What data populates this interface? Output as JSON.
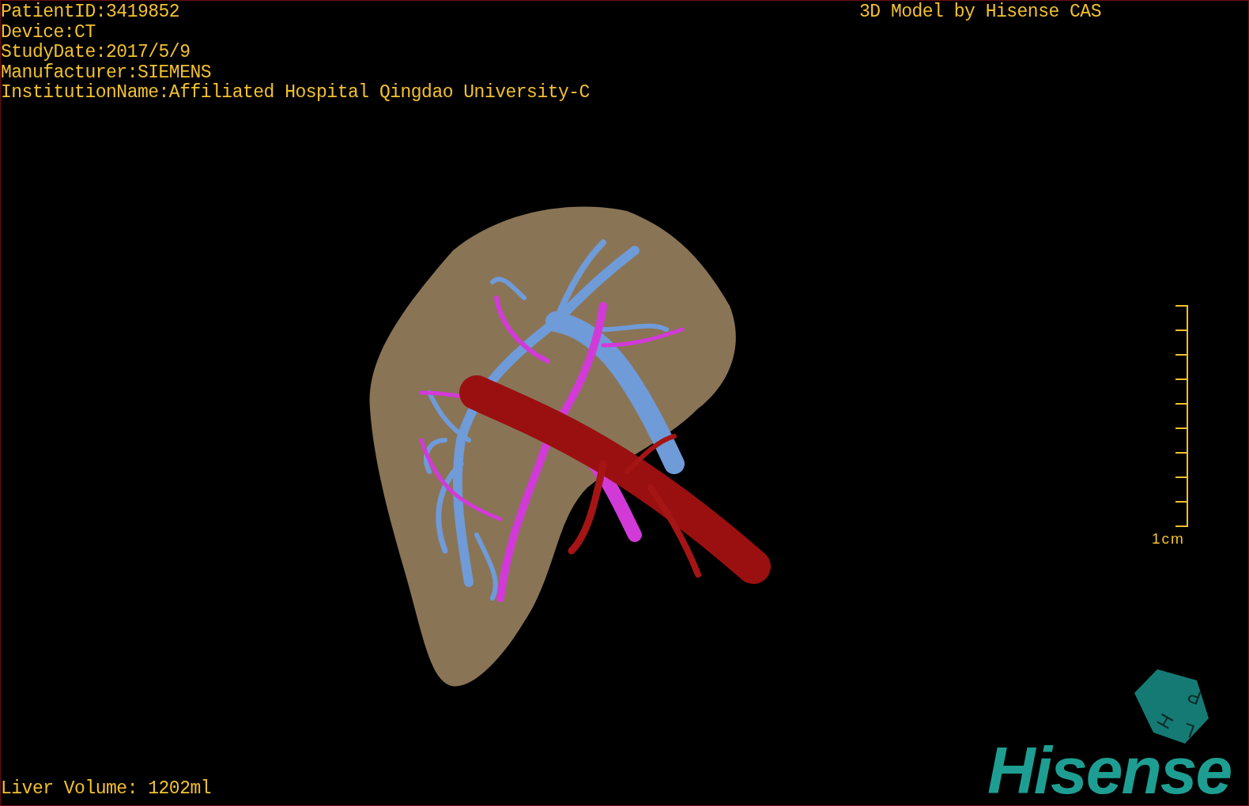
{
  "patient_info": [
    "PatientID:3419852",
    "Device:CT",
    "StudyDate:2017/5/9",
    "Manufacturer:SIEMENS",
    "InstitutionName:Affiliated Hospital Qingdao University-C"
  ],
  "model_credit": "3D Model by Hisense CAS",
  "scale_bar": {
    "label": "1cm"
  },
  "orientation_cube": {
    "faces": [
      "P",
      "L",
      "H"
    ]
  },
  "logo": "Hisense",
  "liver_volume": "Liver Volume: 1202ml"
}
